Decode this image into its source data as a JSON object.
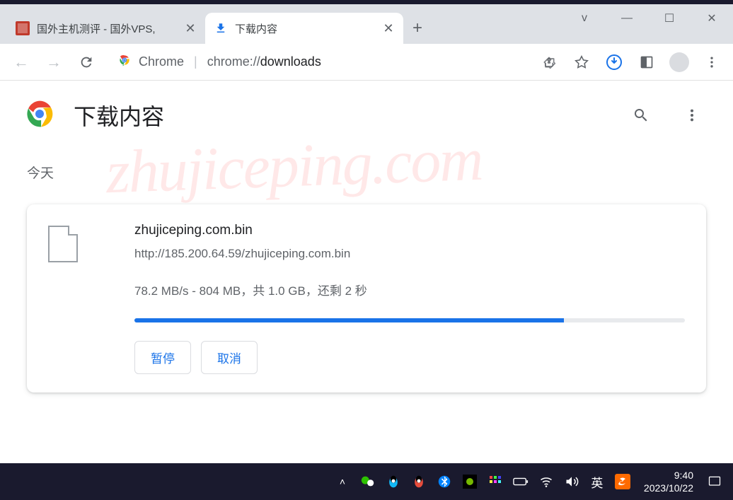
{
  "window": {
    "controls": {
      "min": "—",
      "max": "☐",
      "close": "✕"
    }
  },
  "tabs": [
    {
      "title": "国外主机测评 - 国外VPS,",
      "active": false,
      "favicon_color": "#c0392b"
    },
    {
      "title": "下载内容",
      "active": true,
      "favicon": "download"
    }
  ],
  "toolbar": {
    "url_prefix": "Chrome",
    "url_authority": "chrome://",
    "url_bold": "downloads"
  },
  "page": {
    "title": "下载内容",
    "watermark": "zhujiceping.com",
    "section_today": "今天",
    "download": {
      "filename": "zhujiceping.com.bin",
      "url": "http://185.200.64.59/zhujiceping.com.bin",
      "status_text": "78.2 MB/s - 804 MB，共 1.0 GB，还剩 2 秒",
      "progress_percent": 78,
      "pause_label": "暂停",
      "cancel_label": "取消"
    }
  },
  "taskbar": {
    "ime": "英",
    "time": "9:40",
    "date": "2023/10/22"
  }
}
